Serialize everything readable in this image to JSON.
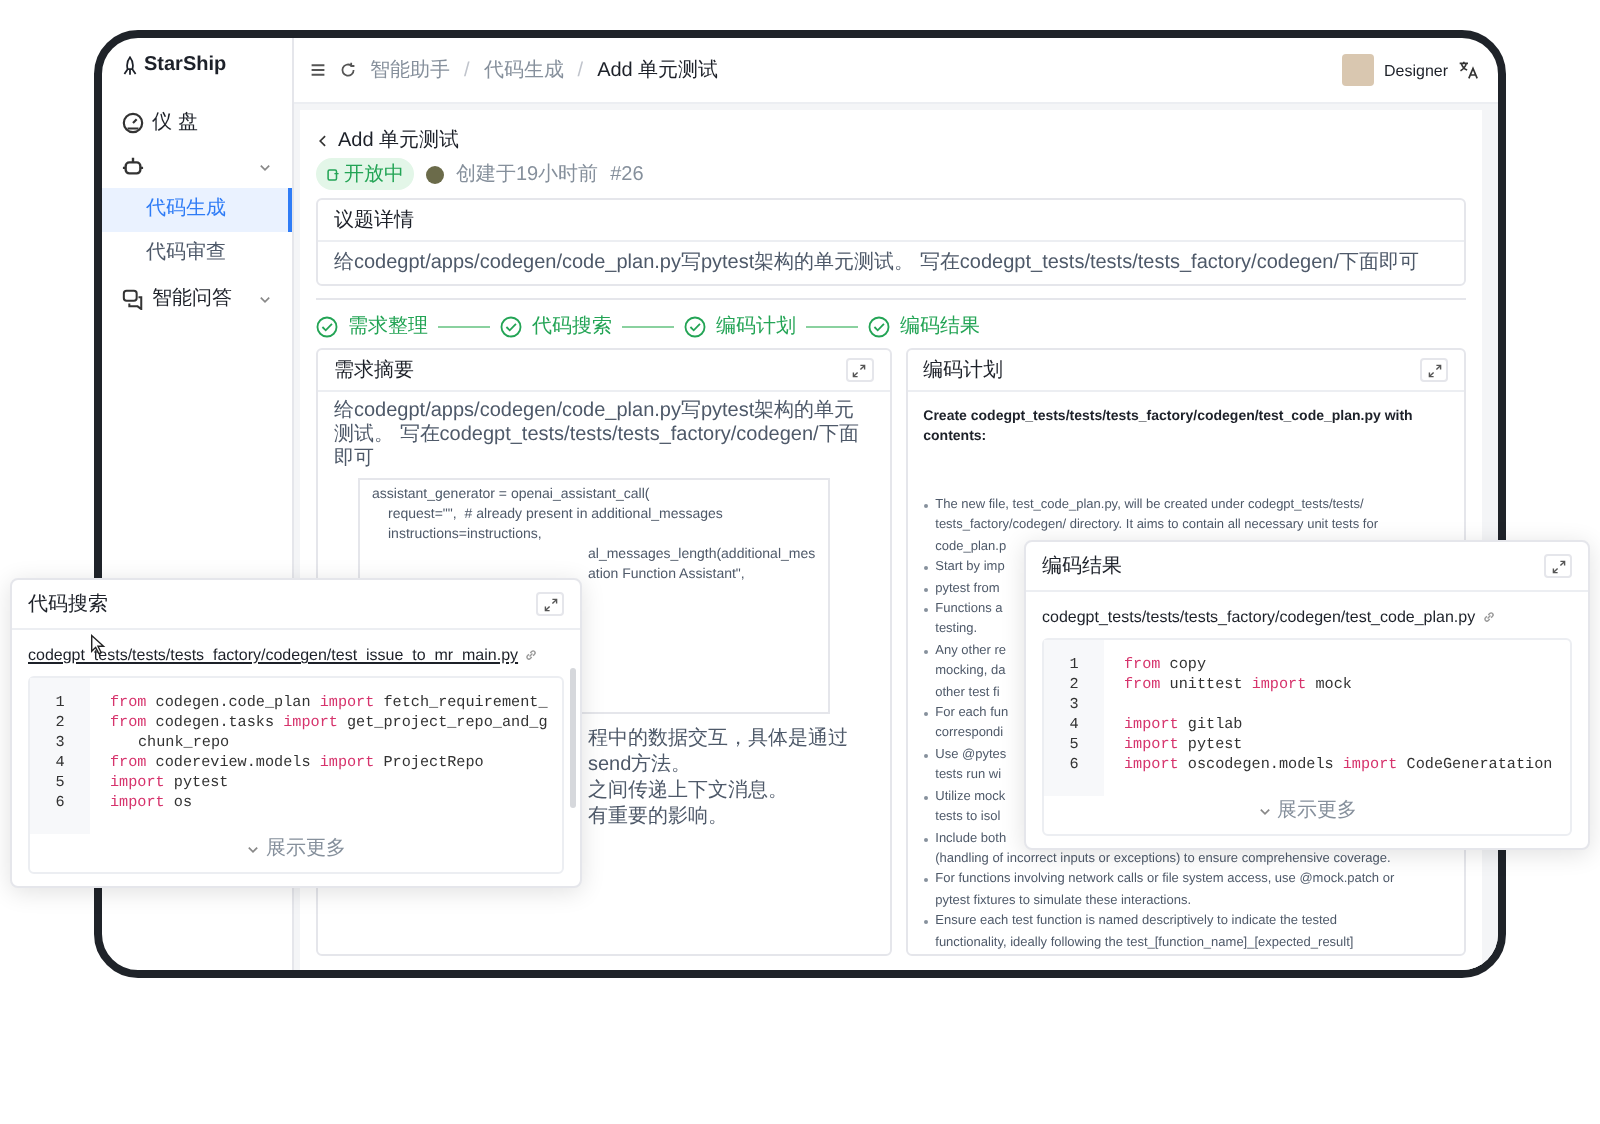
{
  "sidebar": {
    "logo": "StarShip",
    "items": [
      {
        "kind": "link",
        "label": "仪 盘"
      },
      {
        "kind": "group",
        "children": [
          {
            "label": "代码生成",
            "selected": true
          },
          {
            "label": "代码审查",
            "selected": false
          }
        ]
      },
      {
        "kind": "group",
        "label": "智能问答"
      }
    ]
  },
  "header": {
    "breadcrumbs": [
      "智能助手",
      "代码生成",
      "Add 单元测试"
    ],
    "separator": "/",
    "user": {
      "name": "Designer"
    }
  },
  "issue": {
    "title": "Add 单元测试",
    "status": "开放中",
    "created": "创建于19小时前",
    "number": "#26",
    "detail": {
      "title": "议题详情",
      "text": "给codegpt/apps/codegen/code_plan.py写pytest架构的单元测试。 写在codegpt_tests/tests/tests_factory/codegen/下面即可"
    }
  },
  "steps": [
    {
      "label": "需求整理",
      "done": true
    },
    {
      "label": "代码搜索",
      "done": true
    },
    {
      "label": "编码计划",
      "done": true
    },
    {
      "label": "编码结果",
      "done": true
    }
  ],
  "summary": {
    "title": "需求摘要",
    "text": "给codegpt/apps/codegen/code_plan.py写pytest架构的单元测试。 写在codegpt_tests/tests/tests_factory/codegen/下面即可",
    "code_lines": [
      {
        "kind": "head",
        "text": "assistant_generator = openai_assistant_call("
      },
      {
        "kind": "arg",
        "text": "request=\"\",  # already present in additional_messages"
      },
      {
        "kind": "arg",
        "text": "instructions=instructions,"
      },
      {
        "kind": "clipped",
        "text": "al_messages_length(additional_mes"
      },
      {
        "kind": "clipped",
        "text": "ation Function Assistant\","
      }
    ],
    "notes": [
      "程中的数据交互，具体是通过send方法。",
      "之间传递上下文消息。",
      "有重要的影响。"
    ]
  },
  "plan": {
    "title": "编码计划",
    "heading": "Create codegpt_tests/tests/tests_factory/codegen/test_code_plan.py with contents:",
    "bullets": [
      "The new file, test_code_plan.py, will be created under codegpt_tests/tests/\ntests_factory/codegen/ directory. It aims to contain all necessary unit tests for\ncode_plan.p",
      "Start by imp",
      "pytest from",
      "Functions a\ntesting.",
      "Any other re\nmocking, da\nother test fi",
      "For each fun\ncorrespondi",
      "Use @pytes\ntests run wi",
      "Utilize mock\ntests to isol",
      "Include both\n(handling of incorrect inputs or exceptions) to ensure comprehensive coverage.",
      "For functions involving network calls or file system access, use @mock.patch or\npytest fixtures to simulate these interactions.",
      "Ensure each test function is named descriptively to indicate the tested\nfunctionality, ideally following the test_[function_name]_[expected_result]"
    ]
  },
  "search_panel": {
    "title": "代码搜索",
    "file": "codegpt_tests/tests/tests_factory/codegen/test_issue_to_mr_main.py",
    "more": "展示更多",
    "lines": [
      {
        "num": "1",
        "tokens": [
          {
            "kind": "kw",
            "text": "from"
          },
          {
            "kind": "plain",
            "text": " codegen.code_plan "
          },
          {
            "kind": "kw",
            "text": "import"
          },
          {
            "kind": "plain",
            "text": " fetch_requirement_"
          }
        ]
      },
      {
        "num": "2",
        "tokens": [
          {
            "kind": "kw",
            "text": "from"
          },
          {
            "kind": "plain",
            "text": " codegen.tasks "
          },
          {
            "kind": "kw",
            "text": "import"
          },
          {
            "kind": "plain",
            "text": " get_project_repo_and_g"
          }
        ]
      },
      {
        "num": "3",
        "kind": "continuation",
        "tokens": [
          {
            "kind": "plain",
            "text": "chunk_repo"
          }
        ]
      },
      {
        "num": "4",
        "tokens": [
          {
            "kind": "kw",
            "text": "from"
          },
          {
            "kind": "plain",
            "text": " codereview.models "
          },
          {
            "kind": "kw",
            "text": "import"
          },
          {
            "kind": "plain",
            "text": " ProjectRepo"
          }
        ]
      },
      {
        "num": "5",
        "tokens": [
          {
            "kind": "kw",
            "text": "import"
          },
          {
            "kind": "plain",
            "text": " pytest"
          }
        ]
      },
      {
        "num": "6",
        "tokens": [
          {
            "kind": "kw",
            "text": "import"
          },
          {
            "kind": "plain",
            "text": " os"
          }
        ]
      }
    ]
  },
  "result_panel": {
    "title": "编码结果",
    "file": "codegpt_tests/tests/tests_factory/codegen/test_code_plan.py",
    "more": "展示更多",
    "lines": [
      {
        "num": "1",
        "tokens": [
          {
            "kind": "kw",
            "text": "from"
          },
          {
            "kind": "plain",
            "text": " copy"
          }
        ]
      },
      {
        "num": "2",
        "tokens": [
          {
            "kind": "kw",
            "text": "from"
          },
          {
            "kind": "plain",
            "text": " unittest "
          },
          {
            "kind": "kw",
            "text": "import"
          },
          {
            "kind": "plain",
            "text": " mock"
          }
        ]
      },
      {
        "num": "3"
      },
      {
        "num": "4",
        "tokens": [
          {
            "kind": "kw",
            "text": "import"
          },
          {
            "kind": "plain",
            "text": " gitlab"
          }
        ]
      },
      {
        "num": "5",
        "tokens": [
          {
            "kind": "kw",
            "text": "import"
          },
          {
            "kind": "plain",
            "text": " pytest"
          }
        ]
      },
      {
        "num": "6",
        "tokens": [
          {
            "kind": "kw",
            "text": "import"
          },
          {
            "kind": "plain",
            "text": " oscodegen.models "
          },
          {
            "kind": "kw",
            "text": "import"
          },
          {
            "kind": "plain",
            "text": " CodeGeneratation"
          }
        ]
      }
    ]
  }
}
